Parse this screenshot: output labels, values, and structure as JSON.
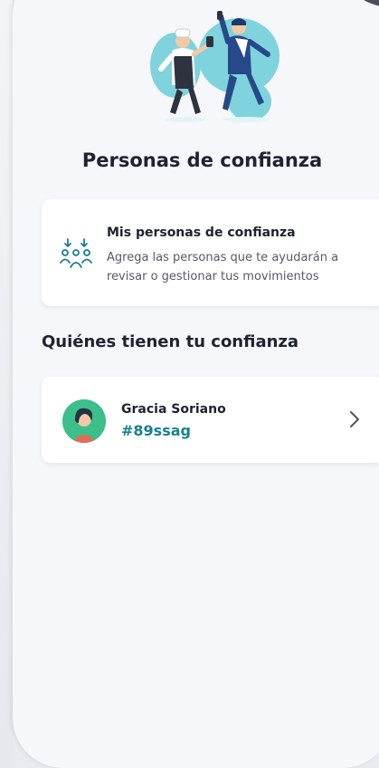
{
  "header": {
    "back_icon": "arrow-left-icon",
    "info_icon": "info-icon"
  },
  "page": {
    "title": "Personas de confianza"
  },
  "trust_card": {
    "icon": "people-group-icon",
    "title": "Mis personas de confianza",
    "description": "Agrega las personas que te ayudarán a revisar o gestionar tus movimientos"
  },
  "section": {
    "title": "Quiénes tienen tu confianza"
  },
  "people": [
    {
      "name": "Gracia Soriano",
      "code": "#89ssag"
    }
  ],
  "colors": {
    "accent": "#1a7f91",
    "background": "#f6f7fb",
    "avatar_bg": "#3cbf8a"
  }
}
